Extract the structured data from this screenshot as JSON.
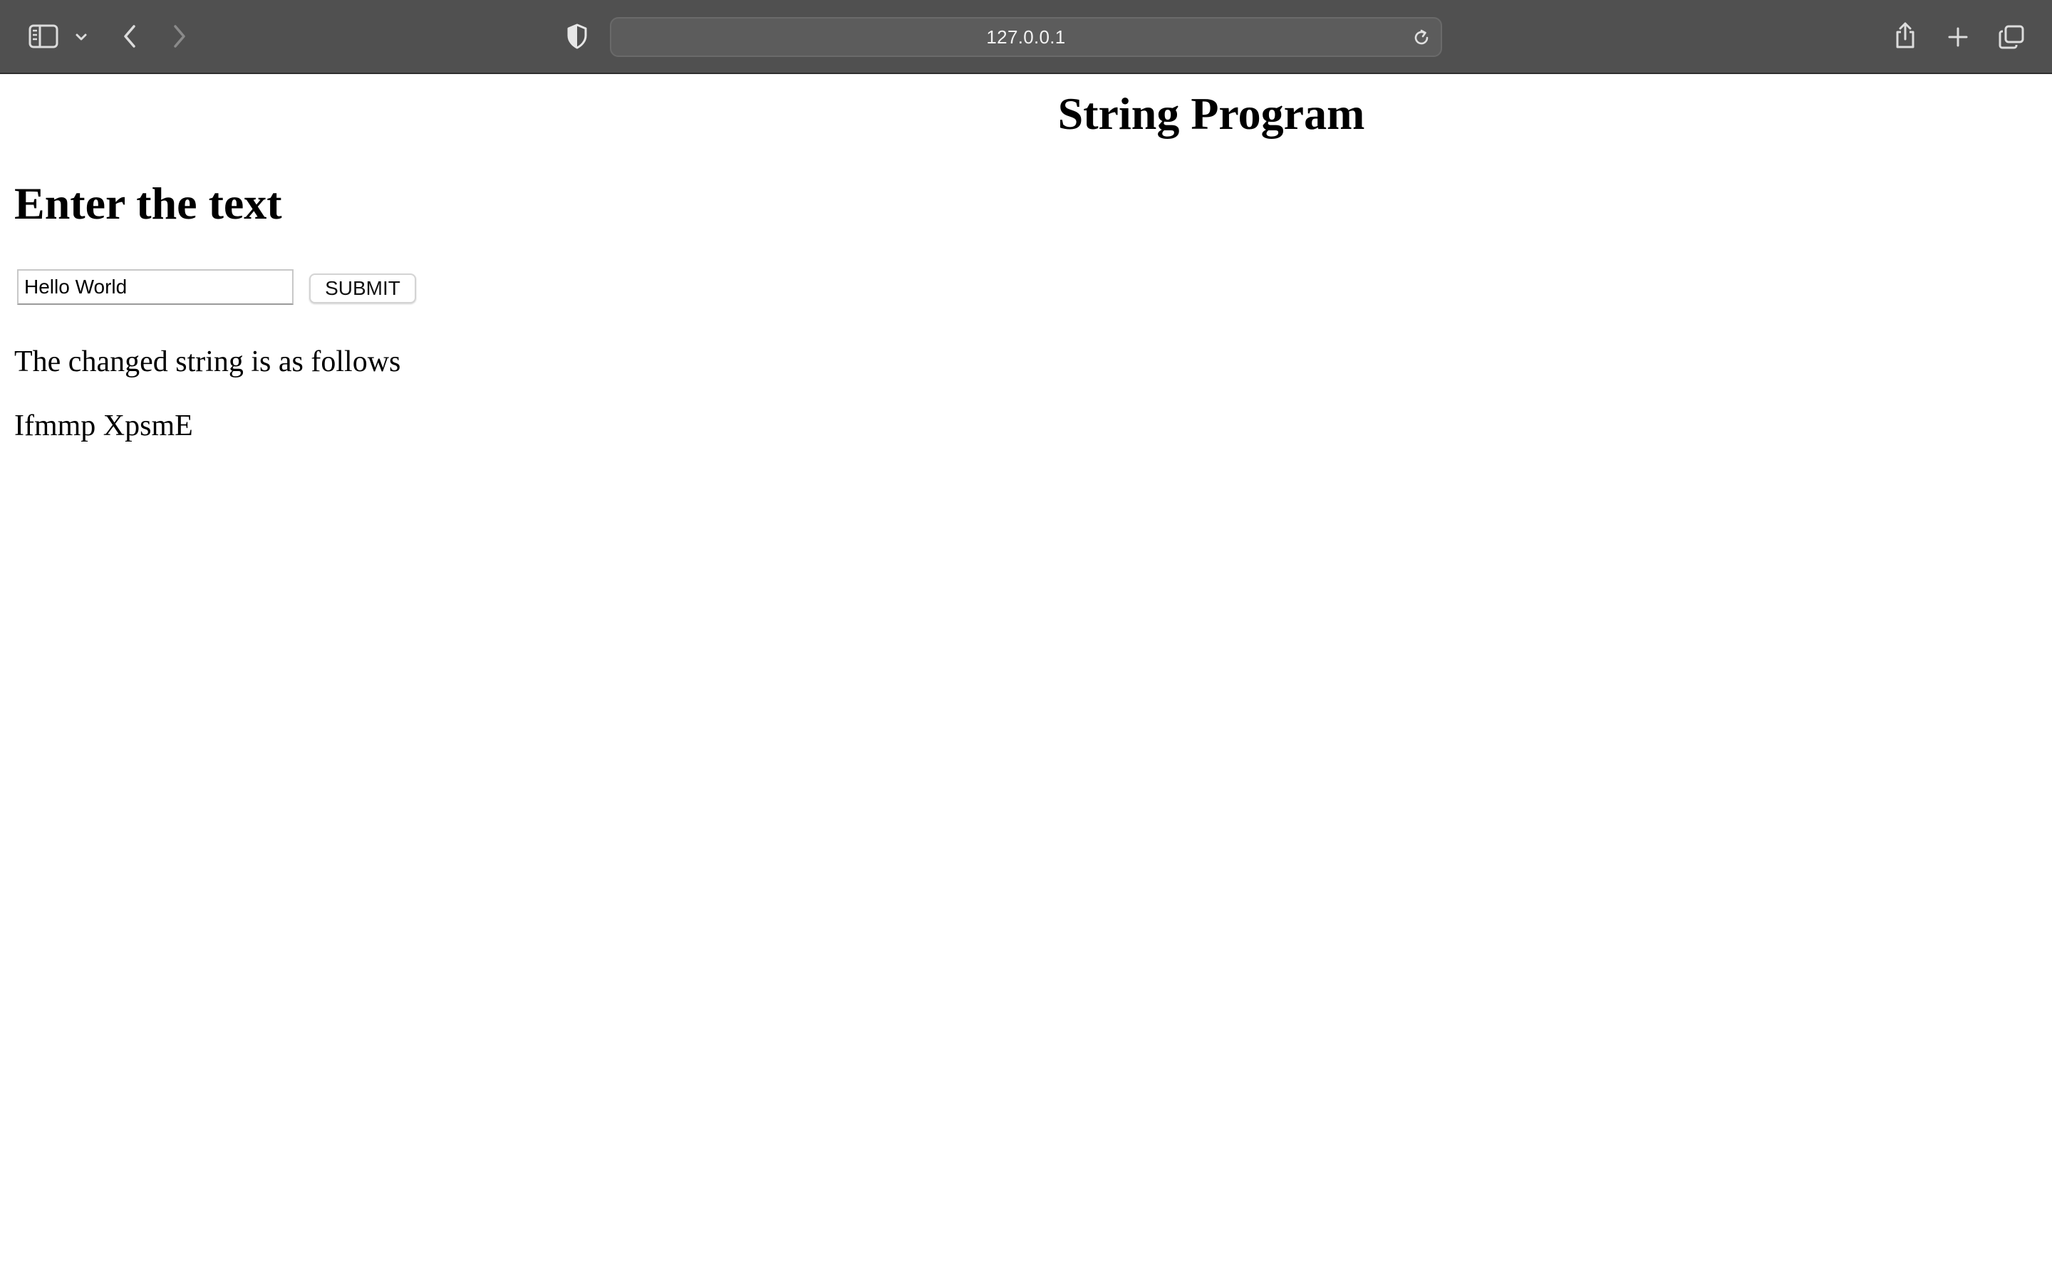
{
  "browser": {
    "url": "127.0.0.1",
    "icons": {
      "sidebar": "sidebar-icon",
      "sidebar_menu": "chevron-down-icon",
      "back": "chevron-left-icon",
      "forward": "chevron-right-icon",
      "privacy": "shield-icon",
      "reload": "reload-icon",
      "share": "share-icon",
      "new_tab": "plus-icon",
      "tab_overview": "tabs-icon"
    },
    "colors": {
      "toolbar": "#505050",
      "urlbar": "#5c5c5c"
    }
  },
  "page": {
    "title": "String Program",
    "heading": "Enter the text",
    "input_value": "Hello World",
    "submit_label": "SUBMIT",
    "result_label": "The changed string is as follows",
    "result_value": "Ifmmp XpsmE"
  }
}
